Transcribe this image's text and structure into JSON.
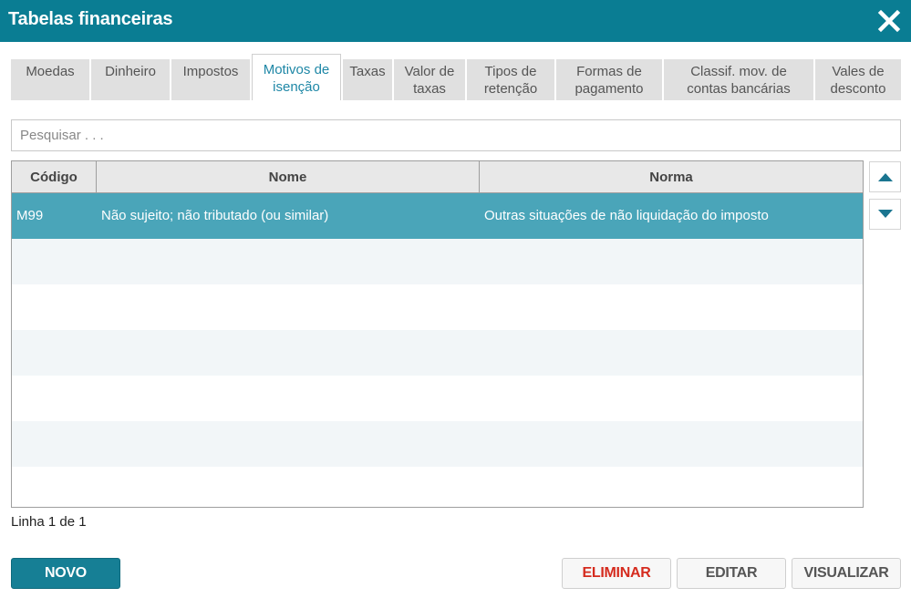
{
  "window": {
    "title": "Tabelas financeiras",
    "close_icon": "close-icon"
  },
  "colors": {
    "title_bar": "#0a7d93",
    "selected_row": "#4aa5b9",
    "active_tab_text": "#1e87a6",
    "primary_button": "#167f95",
    "danger_text": "#d52b1e"
  },
  "tabs": [
    {
      "label": "Moedas",
      "active": false
    },
    {
      "label": "Dinheiro",
      "active": false
    },
    {
      "label": "Impostos",
      "active": false
    },
    {
      "label": "Motivos de\nisenção",
      "active": true
    },
    {
      "label": "Taxas",
      "active": false
    },
    {
      "label": "Valor de\ntaxas",
      "active": false
    },
    {
      "label": "Tipos de\nretenção",
      "active": false
    },
    {
      "label": "Formas de\npagamento",
      "active": false
    },
    {
      "label": "Classif. mov. de\ncontas bancárias",
      "active": false
    },
    {
      "label": "Vales de\ndesconto",
      "active": false
    }
  ],
  "search": {
    "placeholder": "Pesquisar . . .",
    "value": ""
  },
  "grid": {
    "columns": [
      "Código",
      "Nome",
      "Norma"
    ],
    "rows": [
      {
        "codigo": "M99",
        "nome": "Não sujeito; não tributado (ou similar)",
        "norma": "Outras situações de não liquidação do imposto",
        "selected": true
      }
    ]
  },
  "scroll": {
    "up_icon": "triangle-up-icon",
    "down_icon": "triangle-down-icon"
  },
  "status": {
    "text": "Linha 1 de 1"
  },
  "buttons": {
    "novo": "NOVO",
    "eliminar": "ELIMINAR",
    "editar": "EDITAR",
    "visualizar": "VISUALIZAR"
  }
}
